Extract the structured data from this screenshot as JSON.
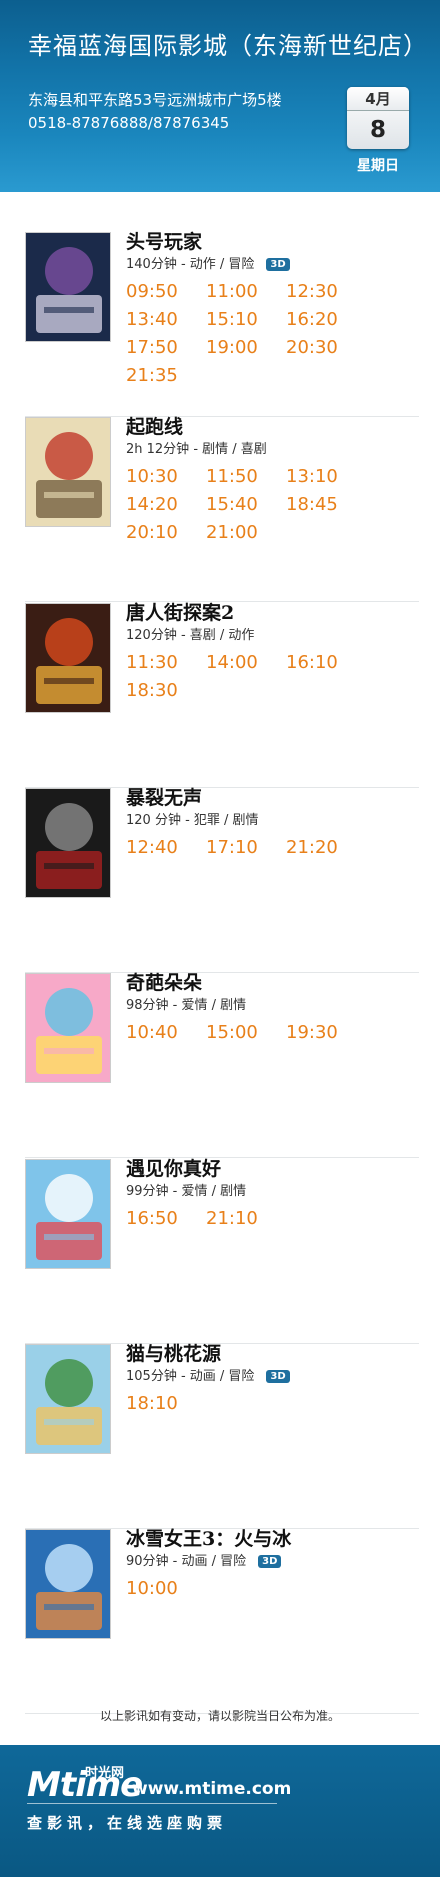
{
  "header": {
    "cinema_name": "幸福蓝海国际影城（东海新世纪店）",
    "address": "东海县和平东路53号远洲城市广场5楼",
    "phone": "0518-87876888/87876345",
    "calendar": {
      "month": "4月",
      "day": "8",
      "weekday": "星期日"
    }
  },
  "badge_label": "3D",
  "movies": [
    {
      "title": "头号玩家",
      "meta": "140分钟 - 动作 / 冒险",
      "is_3d": true,
      "times": [
        "09:50",
        "11:00",
        "12:30",
        "13:40",
        "15:10",
        "16:20",
        "17:50",
        "19:00",
        "20:30",
        "21:35"
      ],
      "poster_colors": [
        "#1b2a4a",
        "#7a4fa0",
        "#d8d4e8"
      ]
    },
    {
      "title": "起跑线",
      "meta": "2h 12分钟 - 剧情 / 喜剧",
      "is_3d": false,
      "times": [
        "10:30",
        "11:50",
        "13:10",
        "14:20",
        "15:40",
        "18:45",
        "20:10",
        "21:00"
      ],
      "poster_colors": [
        "#e9dcb6",
        "#c0392b",
        "#6d5a3a"
      ]
    },
    {
      "title": "唐人街探案2",
      "meta": "120分钟 - 喜剧 / 动作",
      "is_3d": false,
      "times": [
        "11:30",
        "14:00",
        "16:10",
        "18:30"
      ],
      "poster_colors": [
        "#3a1d14",
        "#d84a1b",
        "#f3b23a"
      ]
    },
    {
      "title": "暴裂无声",
      "meta": "120 分钟 - 犯罪 / 剧情",
      "is_3d": false,
      "times": [
        "12:40",
        "17:10",
        "21:20"
      ],
      "poster_colors": [
        "#1a1a1a",
        "#8a8a8a",
        "#b02020"
      ]
    },
    {
      "title": "奇葩朵朵",
      "meta": "98分钟 - 爱情 / 剧情",
      "is_3d": false,
      "times": [
        "10:40",
        "15:00",
        "19:30"
      ],
      "poster_colors": [
        "#f7a9c8",
        "#5fc3e4",
        "#ffe15a"
      ]
    },
    {
      "title": "遇见你真好",
      "meta": "99分钟 - 爱情 / 剧情",
      "is_3d": false,
      "times": [
        "16:50",
        "21:10"
      ],
      "poster_colors": [
        "#7fc4ea",
        "#ffffff",
        "#e8474d"
      ]
    },
    {
      "title": "猫与桃花源",
      "meta": "105分钟 - 动画 / 冒险",
      "is_3d": true,
      "times": [
        "18:10"
      ],
      "poster_colors": [
        "#9ad0e8",
        "#3d8f3d",
        "#f3c35a"
      ]
    },
    {
      "title": "冰雪女王3：火与冰",
      "meta": "90分钟 - 动画 / 冒险",
      "is_3d": true,
      "times": [
        "10:00"
      ],
      "poster_colors": [
        "#2a6fb5",
        "#c6e6ff",
        "#f08a3a"
      ]
    }
  ],
  "notice": "以上影讯如有变动，请以影院当日公布为准。",
  "footer": {
    "logo_text": "Mtime",
    "logo_cn": "时光网",
    "site_url": "www.mtime.com",
    "slogan": "查影讯，在线选座购票"
  }
}
